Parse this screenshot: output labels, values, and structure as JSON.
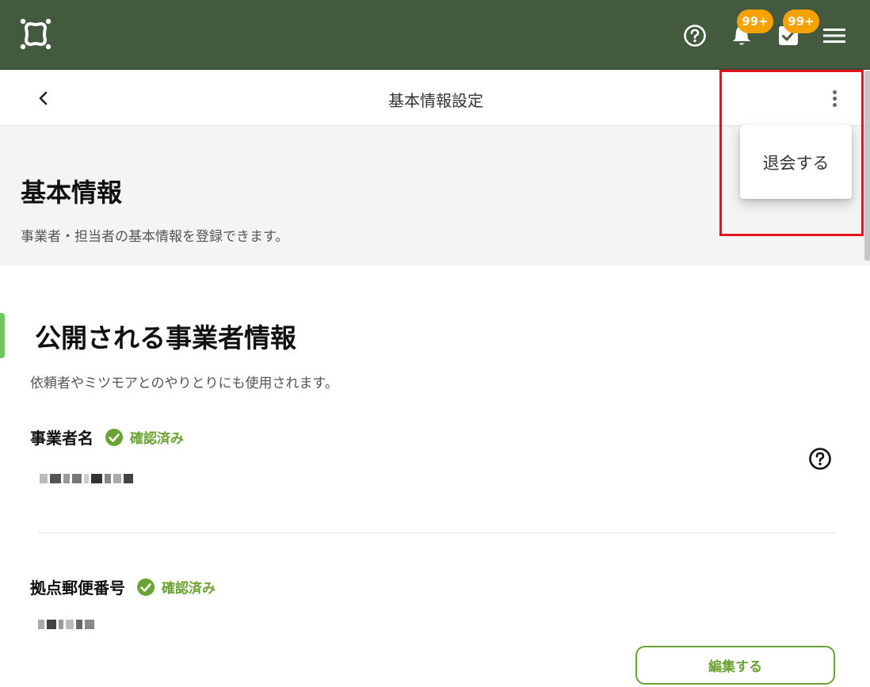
{
  "topbar": {
    "logo_icon": "app-logo-icon",
    "help_icon": "help-circle-icon",
    "notifications": {
      "icon": "bell-icon",
      "badge": "99+"
    },
    "tasks": {
      "icon": "checkbox-icon",
      "badge": "99+"
    },
    "menu_icon": "hamburger-menu-icon",
    "background_color": "#435a3f",
    "badge_color": "#f5a200"
  },
  "subheader": {
    "back_icon": "chevron-left-icon",
    "title": "基本情報設定",
    "more_icon": "more-vertical-icon"
  },
  "dropdown_menu": {
    "items": [
      {
        "label": "退会する"
      }
    ]
  },
  "hero": {
    "title": "基本情報",
    "description": "事業者・担当者の基本情報を登録できます。"
  },
  "section": {
    "title": "公開される事業者情報",
    "description": "依頼者やミツモアとのやりとりにも使用されます。",
    "accent_color": "#6fc45e",
    "fields": [
      {
        "label": "事業者名",
        "status": "確認済み"
      },
      {
        "label": "拠点郵便番号",
        "status": "確認済み"
      }
    ],
    "edit_label": "編集する",
    "verified_color": "#6aa234"
  },
  "highlight_color": "#e3141d"
}
